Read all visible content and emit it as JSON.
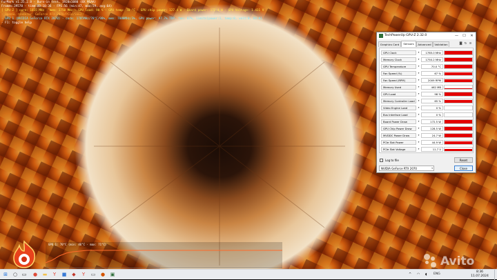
{
  "osd": {
    "lines": [
      {
        "text": "FurMark v1.25.2.0 - Burn-in test, 1920x1080 (8X MSAA)",
        "color": "w"
      },
      {
        "text": "Frames:39570 - time:00:10:36 - FPS:56 (min:47, max:59, avg:64)",
        "color": "w"
      },
      {
        "text": "[ GPU-Z ] core: 1815 MHz - mem: 1750 MHz - GPU load: 98 % - GPU temp: 70 °C - GPU chip power: 127.4 W - Board power: 172.4 W - GPU Voltage: 1.431 V",
        "color": "y"
      },
      {
        "text": "- OpenGL renderer: GeForce RTX 2070/PCIe/SSE2",
        "color": "o"
      },
      {
        "text": "- GPU 1 (NVIDIA GeForce RTX 2070) - core: 1785MHz/70°C/98%, mem: 7000MHz/3%, GPU power: 97.7% TDP, fan: 67%, limits[power:1, temp:0, volt:0, OV:0]",
        "color": "g"
      },
      {
        "text": "- F1: toggle help",
        "color": "w"
      }
    ]
  },
  "temp_graph": {
    "label": "GPU 1: 70°C (min: 46°C - max: 71°C)"
  },
  "gpuz": {
    "title": "TechPowerUp GPU-Z 2.32.0",
    "window_buttons": {
      "minimize": "—",
      "maximize": "☐",
      "close": "✕"
    },
    "tabs": [
      {
        "label": "Graphics Card",
        "active": false
      },
      {
        "label": "Sensors",
        "active": true
      },
      {
        "label": "Advanced",
        "active": false
      },
      {
        "label": "Validation",
        "active": false
      }
    ],
    "toolbar_icons": {
      "camera": "◙",
      "refresh": "↻",
      "menu": "≡"
    },
    "sensors": [
      {
        "name": "GPU Clock",
        "value": "1785.0 MHz",
        "fill": 0.9
      },
      {
        "name": "Memory Clock",
        "value": "1750.2 MHz",
        "fill": 0.9
      },
      {
        "name": "GPU Temperature",
        "value": "70.0 °C",
        "fill": 0.85
      },
      {
        "name": "Fan Speed (%)",
        "value": "67 %",
        "fill": 0.8
      },
      {
        "name": "Fan Speed (RPM)",
        "value": "2009 RPM",
        "fill": 0.8
      },
      {
        "name": "Memory Used",
        "value": "462 MB",
        "fill": 0.1
      },
      {
        "name": "GPU Load",
        "value": "98 %",
        "fill": 0.95
      },
      {
        "name": "Memory Controller Load",
        "value": "65 %",
        "fill": 0.7
      },
      {
        "name": "Video Engine Load",
        "value": "0 %",
        "fill": 0
      },
      {
        "name": "Bus Interface Load",
        "value": "0 %",
        "fill": 0
      },
      {
        "name": "Board Power Draw",
        "value": "172.5 W",
        "fill": 0.9
      },
      {
        "name": "GPU Chip Power Draw",
        "value": "128.5 W",
        "fill": 0.9
      },
      {
        "name": "MVDDC Power Draw",
        "value": "24.7 W",
        "fill": 0.85
      },
      {
        "name": "PCIe Slot Power",
        "value": "44.9 W",
        "fill": 0.8
      },
      {
        "name": "PCIe Slot Voltage",
        "value": "11.7 V",
        "fill": 0.5
      }
    ],
    "log_to_file": "Log to file",
    "reset": "Reset",
    "gpu_select": "NVIDIA GeForce RTX 2070",
    "close": "Close"
  },
  "watermark": "Avito",
  "taskbar": {
    "start_icon": "⊞",
    "search_icon": "○",
    "task_view_icon": "▭",
    "apps": [
      {
        "name": "chrome-icon",
        "glyph": "●",
        "color": "#dd4b39"
      },
      {
        "name": "folder-icon",
        "glyph": "▬",
        "color": "#f2c14e"
      },
      {
        "name": "yandex-icon",
        "glyph": "Y",
        "color": "#e03b2e"
      },
      {
        "name": "app-icon",
        "glyph": "■",
        "color": "#3a7bd5"
      },
      {
        "name": "shield-icon",
        "glyph": "◆",
        "color": "#c0392b"
      },
      {
        "name": "yandex-browser-icon",
        "glyph": "Y",
        "color": "#e03b2e"
      },
      {
        "name": "window-icon",
        "glyph": "▭",
        "color": "#555555"
      },
      {
        "name": "furmark-icon",
        "glyph": "●",
        "color": "#d35400"
      },
      {
        "name": "gpuz-icon",
        "glyph": "▣",
        "color": "#2f6f3a"
      }
    ],
    "tray": {
      "chevron": "^",
      "wifi": "◠",
      "volume": "◖",
      "lang": "ENG"
    },
    "time": "8:36",
    "date": "11.07.2024"
  }
}
